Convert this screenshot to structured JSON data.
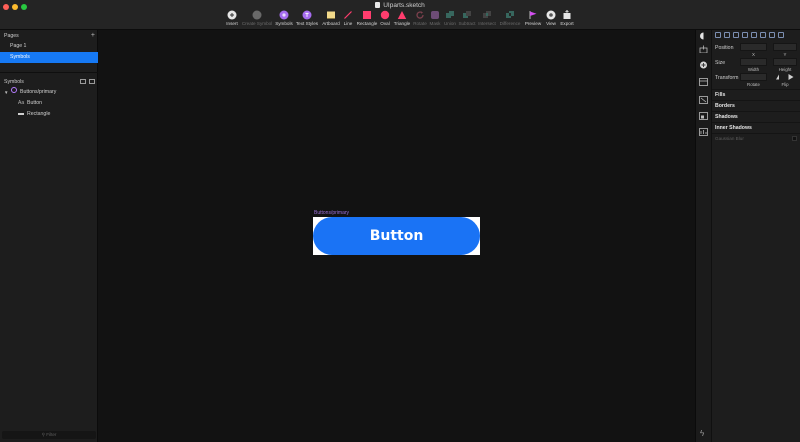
{
  "window": {
    "title": "UIparts.sketch"
  },
  "toolbar": {
    "items": [
      {
        "label": "Insert",
        "icon": "insert-icon",
        "disabled": false
      },
      {
        "label": "Create Symbol",
        "icon": "create-symbol-icon",
        "disabled": true
      },
      {
        "label": "Symbols",
        "icon": "symbols-icon",
        "disabled": false
      },
      {
        "label": "Text Styles",
        "icon": "text-styles-icon",
        "disabled": false
      },
      {
        "label": "Artboard",
        "icon": "artboard-icon",
        "disabled": false
      },
      {
        "label": "Line",
        "icon": "line-icon",
        "disabled": false
      },
      {
        "label": "Rectangle",
        "icon": "rectangle-icon",
        "disabled": false
      },
      {
        "label": "Oval",
        "icon": "oval-icon",
        "disabled": false
      },
      {
        "label": "Triangle",
        "icon": "triangle-icon",
        "disabled": false
      },
      {
        "label": "Rotate",
        "icon": "rotate-icon",
        "disabled": true
      },
      {
        "label": "Mask",
        "icon": "mask-icon",
        "disabled": true
      },
      {
        "label": "Union",
        "icon": "union-icon",
        "disabled": true
      },
      {
        "label": "Subtract",
        "icon": "subtract-icon",
        "disabled": true
      },
      {
        "label": "Intersect",
        "icon": "intersect-icon",
        "disabled": true
      },
      {
        "label": "Difference",
        "icon": "difference-icon",
        "disabled": true
      },
      {
        "label": "Preview",
        "icon": "preview-icon",
        "disabled": false
      },
      {
        "label": "View",
        "icon": "view-icon",
        "disabled": false
      },
      {
        "label": "Export",
        "icon": "export-icon",
        "disabled": false
      }
    ]
  },
  "sidebar": {
    "pages_title": "Pages",
    "pages": [
      {
        "label": "Page 1",
        "selected": false
      },
      {
        "label": "Symbols",
        "selected": true
      }
    ],
    "layers_title": "Symbols",
    "layers": [
      {
        "label": "Buttons/primary",
        "kind": "symbol"
      },
      {
        "label": "Button",
        "kind": "text",
        "icon_glyph": "Aa"
      },
      {
        "label": "Rectangle",
        "kind": "shape"
      }
    ],
    "filter_placeholder": "Filter"
  },
  "canvas": {
    "artboard_label": "Buttons/primary",
    "button_text": "Button"
  },
  "inspector": {
    "position_label": "Position",
    "x_caption": "X",
    "y_caption": "Y",
    "size_label": "Size",
    "width_caption": "Width",
    "height_caption": "Height",
    "transform_label": "Transform",
    "rotate_caption": "Rotate",
    "flip_caption": "Flip",
    "fills": "Fills",
    "borders": "Borders",
    "shadows": "Shadows",
    "inner_shadows": "Inner Shadows",
    "gaussian_blur": "Gaussian Blur"
  },
  "colors": {
    "accent": "#1679f4",
    "button_fill": "#1a73f5",
    "symbol_purple": "#9b6fd6"
  }
}
